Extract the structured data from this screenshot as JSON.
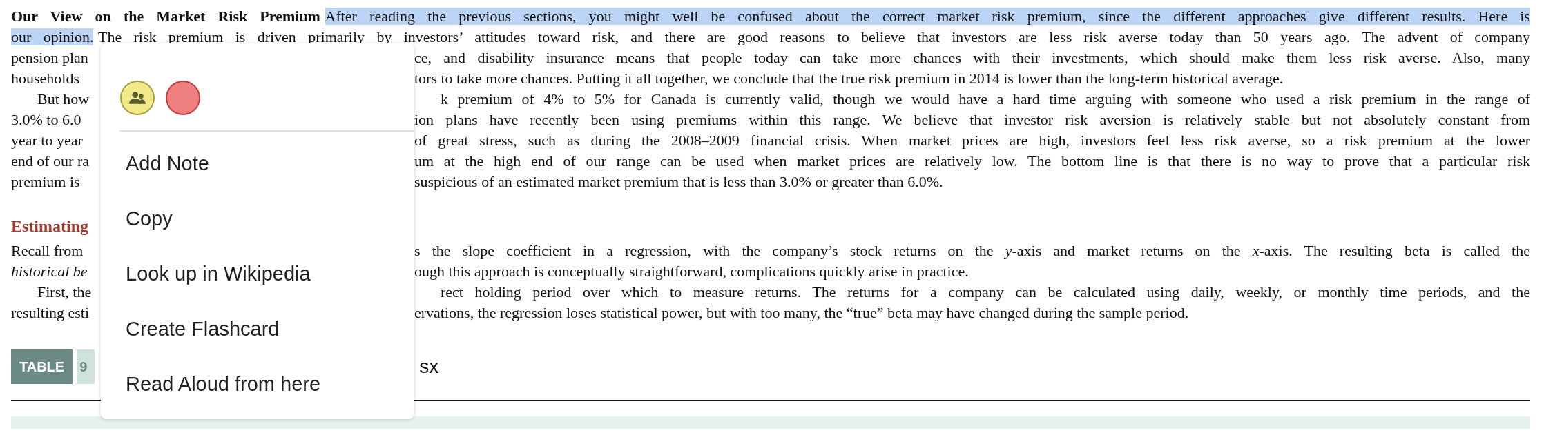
{
  "sections": [
    {
      "paragraphs": [
        {
          "indented": false,
          "lines": [
            {
              "left": [
                {
                  "kind": "bold",
                  "text": "Our View on the Market Risk Premium"
                },
                {
                  "kind": "selected",
                  "text": "After reading the previous sections, you might well be confused about the correct market risk premium, since the different approaches give different results. Here is"
                }
              ]
            },
            {
              "left": [
                {
                  "kind": "selected",
                  "text": "our opinion."
                },
                {
                  "text": "The risk premium is driven primarily by investors’ attitudes toward risk, and there are good reasons to believe that investors are less risk averse today than 50 years ago. The advent of company"
                }
              ]
            },
            {
              "left": [
                {
                  "text": "pension plan"
                }
              ],
              "right": [
                {
                  "text": "ce, and disability insurance means that people today can take more chances with their investments, which should make them less risk averse. Also, many"
                }
              ]
            },
            {
              "left": [
                {
                  "text": "households"
                }
              ],
              "right": [
                {
                  "text": "tors to take more chances. Putting it all together, we conclude that the true risk premium in 2014 is lower than the long-term historical average."
                }
              ]
            }
          ]
        },
        {
          "indented": true,
          "lines": [
            {
              "left": [
                {
                  "text": "But how"
                }
              ],
              "right": [
                {
                  "text": "k premium of 4% to 5% for Canada is currently valid, though we would have a hard time arguing with someone who used a risk premium in the range of"
                }
              ]
            },
            {
              "left": [
                {
                  "text": "3.0% to 6.0"
                }
              ],
              "right": [
                {
                  "text": "ion plans have recently been using premiums within this range. We believe that investor risk aversion is relatively stable but not absolutely constant from"
                }
              ]
            },
            {
              "left": [
                {
                  "text": "year to year"
                }
              ],
              "right": [
                {
                  "text": "of great stress, such as during the 2008–2009 financial crisis. When market prices are high, investors feel less risk averse, so a risk premium at the lower"
                }
              ]
            },
            {
              "left": [
                {
                  "text": "end of our ra"
                }
              ],
              "right": [
                {
                  "text": "um at the high end of our range can be used when market prices are relatively low. The bottom line is that there is no way to prove that a particular risk"
                }
              ]
            },
            {
              "left": [
                {
                  "text": "premium is"
                }
              ],
              "right": [
                {
                  "text": "suspicious of an estimated market premium that is less than 3.0% or greater than 6.0%."
                }
              ]
            }
          ]
        }
      ]
    },
    {
      "heading": "Estimating",
      "paragraphs": [
        {
          "indented": false,
          "lines": [
            {
              "left": [
                {
                  "text": "Recall from"
                }
              ],
              "right": [
                {
                  "text": "s the slope coefficient in a regression, with the company’s stock returns on the *y*-axis and market returns on the *x*-axis. The resulting beta is called the"
                }
              ]
            },
            {
              "left": [
                {
                  "kind": "italic",
                  "text": "historical be"
                }
              ],
              "right": [
                {
                  "text": "ough this approach is conceptually straightforward, complications quickly arise in practice."
                }
              ]
            }
          ]
        },
        {
          "indented": true,
          "lines": [
            {
              "left": [
                {
                  "text": "First, the"
                }
              ],
              "right": [
                {
                  "text": "rect holding period over which to measure returns. The returns for a company can be calculated using daily, weekly, or monthly time periods, and the"
                }
              ]
            },
            {
              "left": [
                {
                  "text": "resulting esti"
                }
              ],
              "right": [
                {
                  "text": "ervations, the regression loses statistical power, but with too many, the “true” beta may have changed during the sample period."
                }
              ]
            }
          ]
        }
      ]
    }
  ],
  "table_caption": {
    "badge": "TABLE",
    "number": "9",
    "title": "sx"
  },
  "context_menu": {
    "swatches": [
      {
        "kind": "group",
        "color": "#f2ea8a"
      },
      {
        "kind": "plain",
        "color": "#ef8080"
      }
    ],
    "items": [
      "Add Note",
      "Copy",
      "Look up in Wikipedia",
      "Create Flashcard",
      "Read Aloud from here"
    ]
  }
}
